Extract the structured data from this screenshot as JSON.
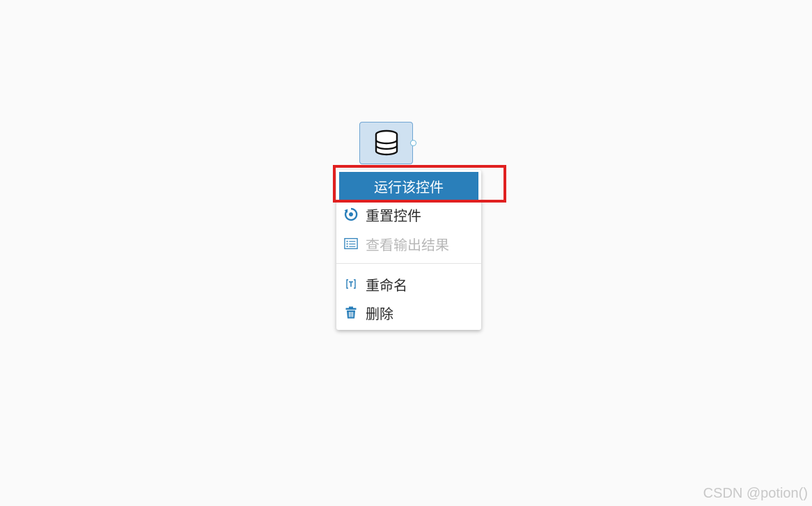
{
  "node": {
    "icon": "database-icon"
  },
  "context_menu": {
    "items": [
      {
        "label": "运行该控件",
        "icon": "",
        "state": "highlighted"
      },
      {
        "label": "重置控件",
        "icon": "reset-icon",
        "state": "normal"
      },
      {
        "label": "查看输出结果",
        "icon": "list-icon",
        "state": "disabled"
      },
      {
        "label": "重命名",
        "icon": "rename-icon",
        "state": "normal"
      },
      {
        "label": "删除",
        "icon": "trash-icon",
        "state": "normal"
      }
    ]
  },
  "colors": {
    "accent": "#2a7fba",
    "node_fill": "#cfe1f1",
    "annotation": "#e02020",
    "disabled_text": "#b8b8b8"
  },
  "watermark": "CSDN @potion()"
}
